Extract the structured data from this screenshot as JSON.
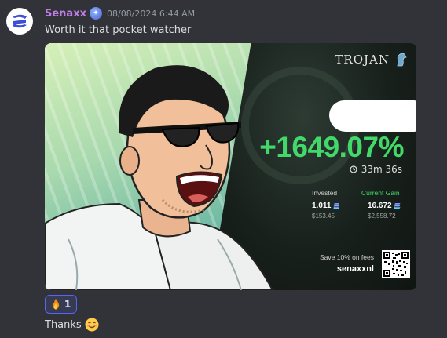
{
  "message": {
    "avatar_icon": "s-logo-icon",
    "username": "Senaxx",
    "role_icon": "brain-icon",
    "timestamp": "08/08/2024 6:44 AM",
    "text": "Worth it that pocket watcher"
  },
  "card": {
    "brand": "TROJAN",
    "brand_icon": "horse-head-icon",
    "gain": "+1649.07%",
    "timer": "33m 36s",
    "timer_icon": "clock-icon",
    "invested": {
      "label": "Invested",
      "value": "1.011",
      "usd": "$153.45"
    },
    "current_gain": {
      "label": "Current Gain",
      "value": "16.672",
      "usd": "$2,558.72"
    },
    "fees_text": "Save 10% on fees",
    "referral_code": "senaxxnl",
    "colors": {
      "gain": "#43d96a",
      "label_green": "#43d96a",
      "label_grey": "#c9cdca"
    }
  },
  "reaction": {
    "emoji": "fire-icon",
    "count": "1"
  },
  "reply": {
    "text": "Thanks",
    "emoji": "smiling-face-icon"
  }
}
